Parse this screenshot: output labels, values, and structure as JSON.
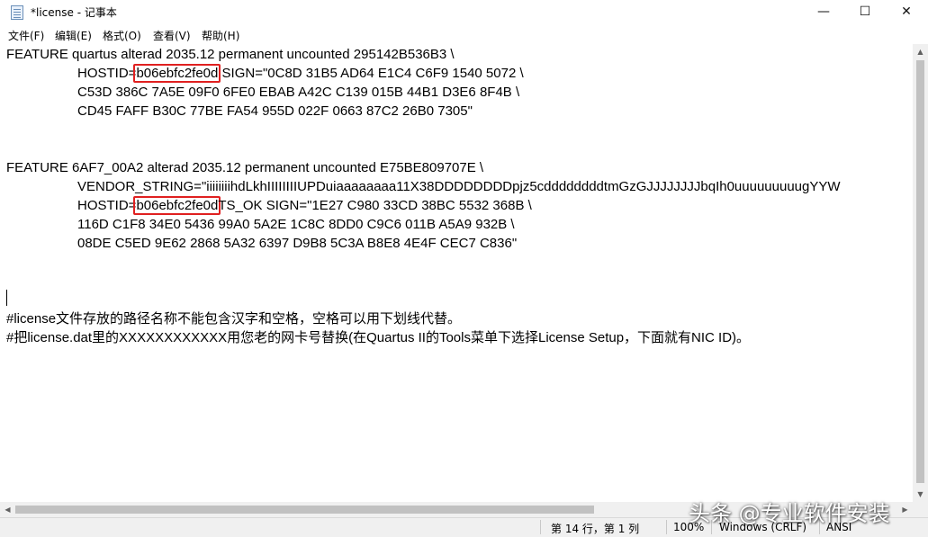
{
  "window": {
    "title": "*license - 记事本",
    "minimize_glyph": "—",
    "maximize_glyph": "☐",
    "close_glyph": "✕"
  },
  "menu": {
    "items": [
      "文件(F)",
      "编辑(E)",
      "格式(O)",
      "查看(V)",
      "帮助(H)"
    ]
  },
  "editor": {
    "lines": {
      "l1": "FEATURE quartus alterad 2035.12 permanent uncounted 295142B536B3 \\",
      "l2_a": "HOSTID=",
      "l2_hl": "b06ebfc2fe0d",
      "l2_b": " SIGN=\"0C8D 31B5 AD64 E1C4 C6F9 1540 5072 \\",
      "l3": "C53D 386C 7A5E 09F0 6FE0 EBAB A42C C139 015B 44B1 D3E6 8F4B \\",
      "l4": "CD45 FAFF B30C 77BE FA54 955D 022F 0663 87C2 26B0 7305\"",
      "l7": "FEATURE 6AF7_00A2 alterad 2035.12 permanent uncounted E75BE809707E \\",
      "l8": "VENDOR_STRING=\"iiiiiiiihdLkhIIIIIIIIUPDuiaaaaaaaa11X38DDDDDDDDpjz5cddddddddtmGzGJJJJJJJJbqIh0uuuuuuuuugYYW",
      "l9_a": "HOSTID=",
      "l9_hl": "b06ebfc2fe0d",
      "l9_b": "TS_OK SIGN=\"1E27 C980 33CD 38BC 5532 368B \\",
      "l10": "116D C1F8 34E0 5436 99A0 5A2E 1C8C 8DD0 C9C6 011B A5A9 932B \\",
      "l11": "08DE C5ED 9E62 2868 5A32 6397 D9B8 5C3A B8E8 4E4F CEC7 C836\"",
      "l15": "#license文件存放的路径名称不能包含汉字和空格，空格可以用下划线代替。",
      "l16": "#把license.dat里的XXXXXXXXXXXX用您老的网卡号替换(在Quartus II的Tools菜单下选择License Setup，下面就有NIC ID)。"
    },
    "highlight_color": "#e02020"
  },
  "statusbar": {
    "position": "第 14 行，第 1 列",
    "zoom": "100%",
    "line_ending": "Windows (CRLF)",
    "encoding": "ANSI"
  },
  "watermark": "头条 @专业软件安装"
}
